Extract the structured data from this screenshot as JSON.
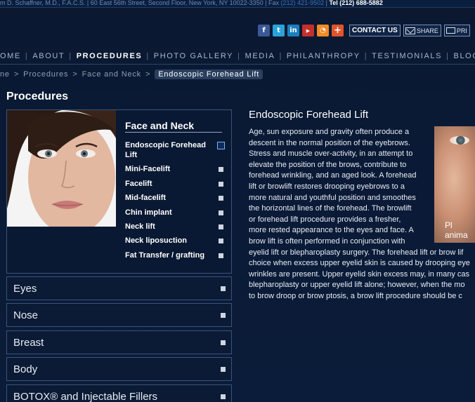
{
  "topbar": {
    "address": "m D. Schaffner, M.D., F.A.C.S. | 60 East 56th Street, Second Floor, New York, NY 10022-3350 | Fax ",
    "fax": "(212) 421-9502",
    "sep": " | ",
    "tel": "Tel (212) 688-5882"
  },
  "social": {
    "icons": [
      "facebook-icon",
      "twitter-icon",
      "linkedin-icon",
      "youtube-icon",
      "rss-icon",
      "plus-icon"
    ],
    "contact_label": "CONTACT US",
    "share_label": "SHARE",
    "print_label": "PRI"
  },
  "nav": {
    "items": [
      "OME",
      "ABOUT",
      "PROCEDURES",
      "PHOTO GALLERY",
      "MEDIA",
      "PHILANTHROPY",
      "TESTIMONIALS",
      "BLOG"
    ],
    "active": "PROCEDURES"
  },
  "breadcrumb": {
    "items": [
      "ne",
      "Procedures",
      "Face and Neck"
    ],
    "current": "Endoscopic Forehead Lift"
  },
  "sidebar": {
    "title": "Procedures",
    "face_panel": {
      "heading": "Face and Neck",
      "items": [
        "Endoscopic Forehead Lift",
        "Mini-Facelift",
        "Facelift",
        "Mid-facelift",
        "Chin implant",
        "Neck lift",
        "Neck liposuction",
        "Fat Transfer / grafting"
      ]
    },
    "accordion": [
      "Eyes",
      "Nose",
      "Breast",
      "Body",
      "BOTOX® and Injectable Fillers"
    ]
  },
  "article": {
    "title": "Endoscopic Forehead Lift",
    "lines": [
      "Age, sun exposure and gravity often produce a",
      "descent in the normal position of the eyebrows.",
      "Stress and muscle over-activity, in an attempt to",
      "elevate the position of the brows, contribute to",
      "forehead wrinkling, and an aged look.  A forehead",
      "lift or browlift restores drooping eyebrows to a",
      "more natural and youthful position and smoothes",
      "the horizontal lines of the forehead.  The browlift",
      "or forehead lift procedure provides a fresher,",
      "more rested appearance to the eyes and face.  A",
      "brow lift is often performed in conjunction with",
      "eyelid lift or blepharoplasty surgery.  The forehead lift or brow lif",
      "choice when excess upper eyelid skin is caused by drooping eye",
      "wrinkles are present.  Upper eyelid skin excess may, in many cas",
      "blepharoplasty or upper eyelid lift alone; however, when the mo",
      "to brow droop or brow ptosis, a brow lift procedure should be c"
    ],
    "photo_caption": [
      "Pl",
      "anima"
    ]
  },
  "colors": {
    "background": "#0a1a36",
    "panel_border": "#3a5479",
    "accent_blue": "#3d6fb7"
  }
}
